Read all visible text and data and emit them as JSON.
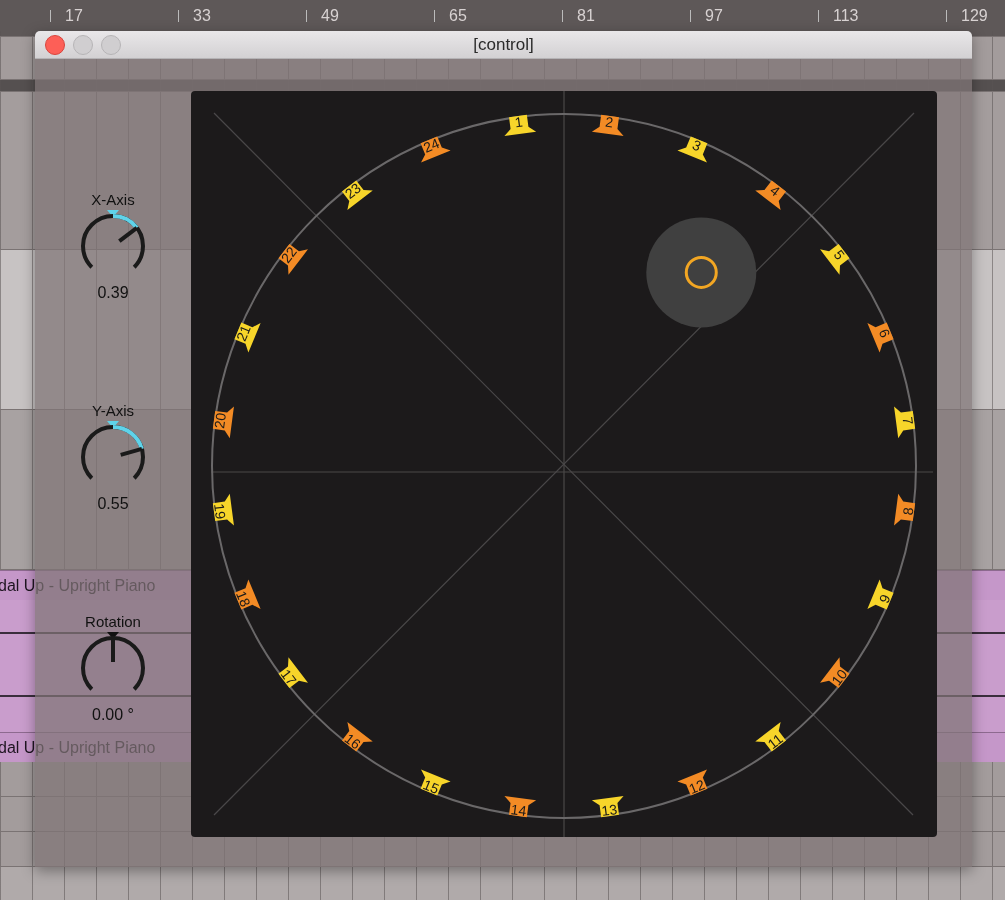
{
  "ruler": {
    "labels": [
      "17",
      "33",
      "49",
      "65",
      "81",
      "97",
      "113",
      "129"
    ]
  },
  "clips": [
    {
      "label": "dal Up - Upright Piano"
    },
    {
      "label": "dal Up - Upright Piano"
    }
  ],
  "window": {
    "title": "[control]",
    "buttons": [
      {
        "kind": "close",
        "disabled": false
      },
      {
        "kind": "minimize",
        "disabled": true
      },
      {
        "kind": "zoom",
        "disabled": true
      }
    ]
  },
  "knobs": [
    {
      "label": "X-Axis",
      "level": 0.695,
      "reading": "0.39"
    },
    {
      "label": "Y-Axis",
      "level": 0.775,
      "reading": "0.55"
    },
    {
      "label": "Rotation",
      "level": 0.5,
      "reading": "0.00 °"
    }
  ],
  "speakers": [
    {
      "label": "1",
      "color": "#f7d52a"
    },
    {
      "label": "2",
      "color": "#f38b25"
    },
    {
      "label": "3",
      "color": "#f7d52a"
    },
    {
      "label": "4",
      "color": "#f38b25"
    },
    {
      "label": "5",
      "color": "#f7d52a"
    },
    {
      "label": "6",
      "color": "#f38b25"
    },
    {
      "label": "7",
      "color": "#f7d52a"
    },
    {
      "label": "8",
      "color": "#f38b25"
    },
    {
      "label": "9",
      "color": "#f7d52a"
    },
    {
      "label": "10",
      "color": "#f38b25"
    },
    {
      "label": "11",
      "color": "#f7d52a"
    },
    {
      "label": "12",
      "color": "#f38b25"
    },
    {
      "label": "13",
      "color": "#f7d52a"
    },
    {
      "label": "14",
      "color": "#f38b25"
    },
    {
      "label": "15",
      "color": "#f7d52a"
    },
    {
      "label": "16",
      "color": "#f38b25"
    },
    {
      "label": "17",
      "color": "#f7d52a"
    },
    {
      "label": "18",
      "color": "#f38b25"
    },
    {
      "label": "19",
      "color": "#f7d52a"
    },
    {
      "label": "20",
      "color": "#f38b25"
    },
    {
      "label": "21",
      "color": "#f7d52a"
    },
    {
      "label": "22",
      "color": "#f38b25"
    },
    {
      "label": "23",
      "color": "#f7d52a"
    },
    {
      "label": "24",
      "color": "#f38b25"
    }
  ]
}
